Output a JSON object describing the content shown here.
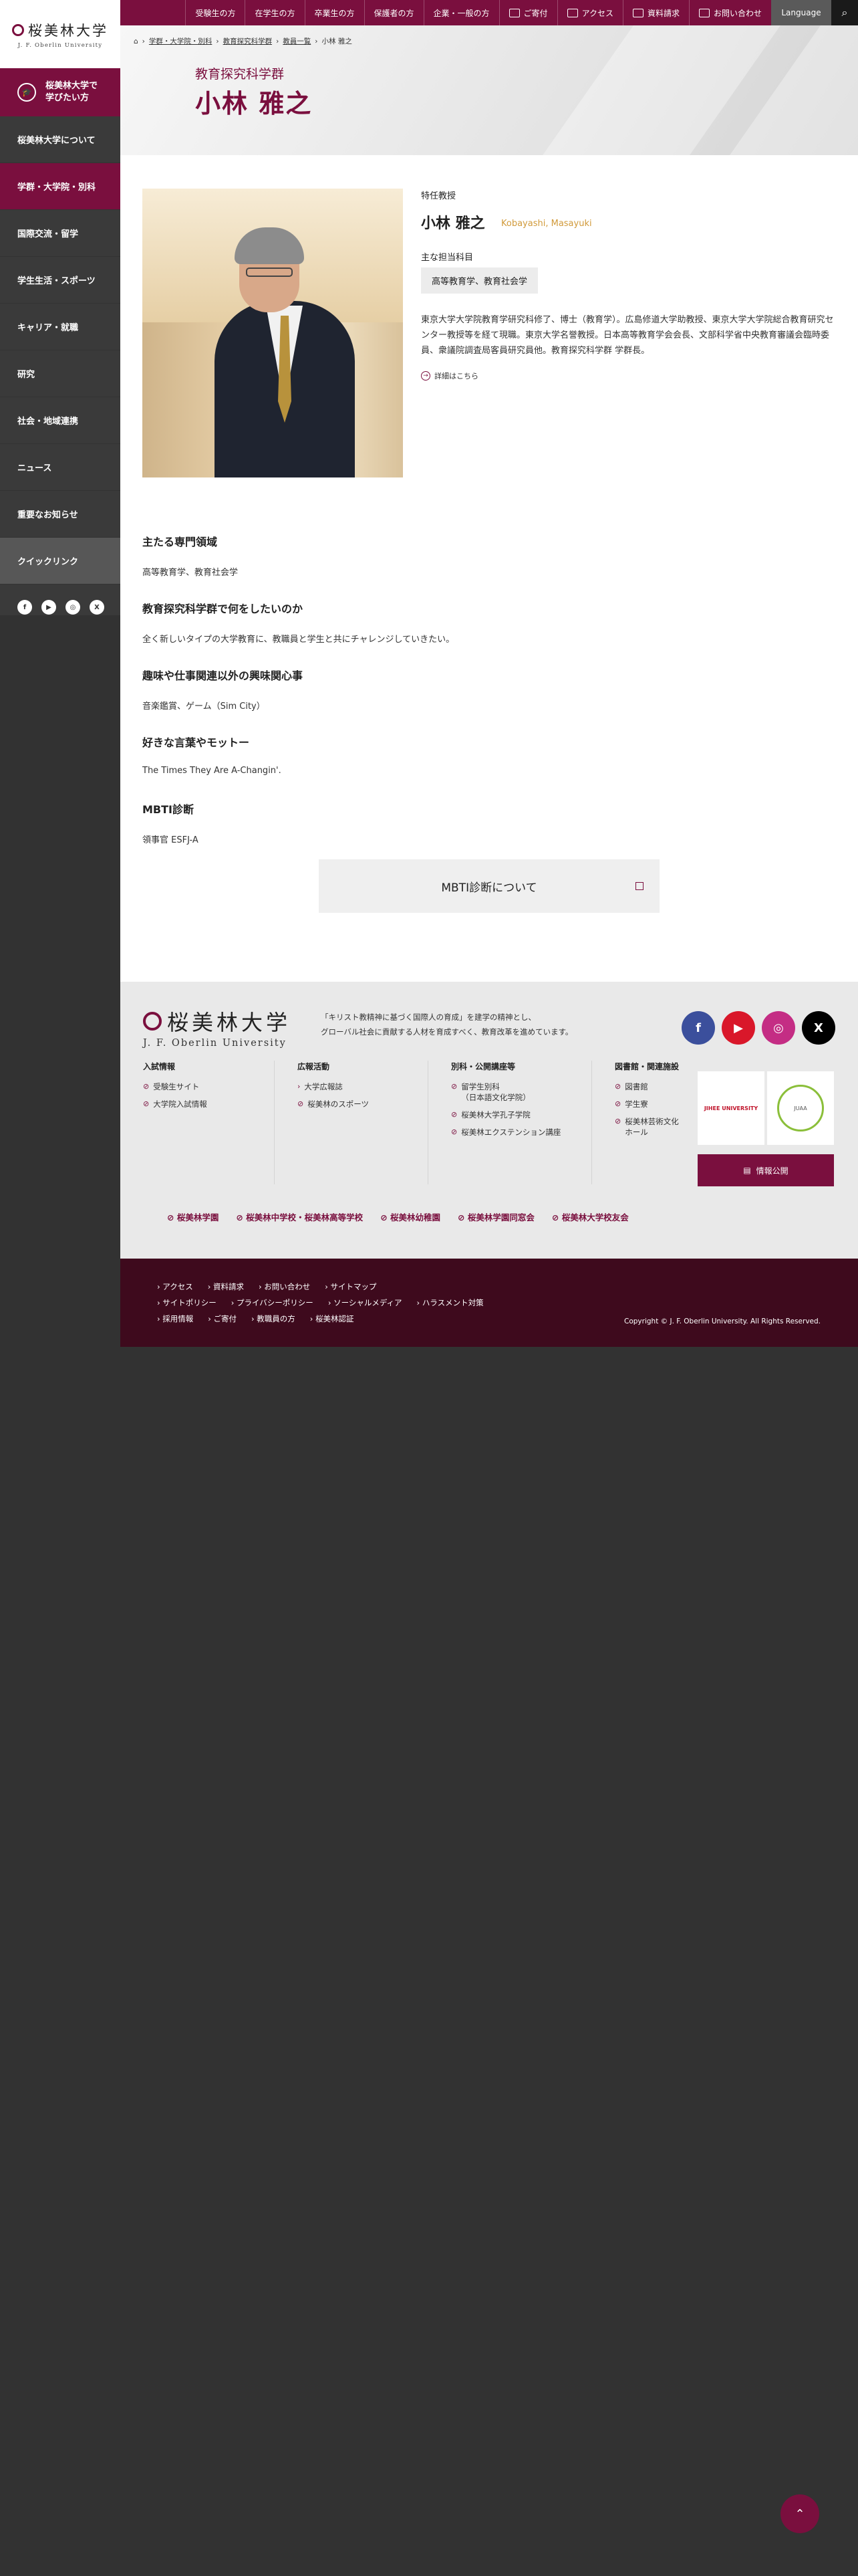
{
  "sidebar": {
    "logo_jp": "桜美林大学",
    "logo_en": "J. F. Oberlin University",
    "learn_label": "桜美林大学で\n学びたい方",
    "items": [
      {
        "label": "桜美林大学について"
      },
      {
        "label": "学群・大学院・別科"
      },
      {
        "label": "国際交流・留学"
      },
      {
        "label": "学生生活・スポーツ"
      },
      {
        "label": "キャリア・就職"
      },
      {
        "label": "研究"
      },
      {
        "label": "社会・地域連携"
      },
      {
        "label": "ニュース"
      },
      {
        "label": "重要なお知らせ"
      }
    ],
    "quick_link": "クイックリンク"
  },
  "topbar": {
    "links": [
      "受験生の方",
      "在学生の方",
      "卒業生の方",
      "保護者の方",
      "企業・一般の方"
    ],
    "icon_links": [
      "ご寄付",
      "アクセス",
      "資料請求",
      "お問い合わせ"
    ],
    "language": "Language"
  },
  "breadcrumb": [
    "学群・大学院・別科",
    "教育探究科学群",
    "教員一覧",
    "小林 雅之"
  ],
  "hero": {
    "department": "教育探究科学群",
    "name": "小林 雅之"
  },
  "profile": {
    "rank": "特任教授",
    "name": "小林 雅之",
    "romaji": "Kobayashi, Masayuki",
    "subjects_label": "主な担当科目",
    "subjects": "高等教育学、教育社会学",
    "bio": "東京大学大学院教育学研究科修了、博士（教育学）。広島修道大学助教授、東京大学大学院総合教育研究センター教授等を経て現職。東京大学名誉教授。日本高等教育学会会長、文部科学省中央教育審議会臨時委員、衆議院調査局客員研究員他。教育探究科学群 学群長。",
    "more_label": "詳細はこちら"
  },
  "sections": [
    {
      "heading": "主たる専門領域",
      "text": "高等教育学、教育社会学"
    },
    {
      "heading": "教育探究科学群で何をしたいのか",
      "text": "全く新しいタイプの大学教育に、教職員と学生と共にチャレンジしていきたい。"
    },
    {
      "heading": "趣味や仕事関連以外の興味関心事",
      "text": "音楽鑑賞、ゲーム（Sim City）"
    },
    {
      "heading": "好きな言葉やモットー",
      "text": "The Times They Are A-Changin'."
    },
    {
      "heading": "MBTI診断",
      "text": "領事官 ESFJ-A"
    }
  ],
  "mbti_button": "MBTI診断について",
  "footer": {
    "logo_jp": "桜美林大学",
    "logo_en": "J. F. Oberlin University",
    "tagline": "「キリスト教精神に基づく国際人の育成」を建学の精神とし、\nグローバル社会に貢献する人材を育成すべく、教育改革を進めています。",
    "columns": [
      {
        "title": "入試情報",
        "links": [
          "受験生サイト",
          "大学院入試情報"
        ]
      },
      {
        "title": "広報活動",
        "links": [
          "大学広報誌",
          "桜美林のスポーツ"
        ]
      },
      {
        "title": "別科・公開講座等",
        "links": [
          "留学生別科\n（日本語文化学院）",
          "桜美林大学孔子学院",
          "桜美林エクステンション講座"
        ]
      },
      {
        "title": "図書館・関連施設",
        "links": [
          "図書館",
          "学生寮",
          "桜美林芸術文化\nホール"
        ]
      }
    ],
    "cert1": "JIHEE UNIVERSITY",
    "cert2": "JUAA",
    "disclosure": "情報公開",
    "affiliates": [
      "桜美林学園",
      "桜美林中学校・桜美林高等学校",
      "桜美林幼稚園",
      "桜美林学園同窓会",
      "桜美林大学校友会"
    ],
    "bottom_links": [
      [
        "アクセス",
        "資料請求",
        "お問い合わせ",
        "サイトマップ"
      ],
      [
        "サイトポリシー",
        "プライバシーポリシー",
        "ソーシャルメディア",
        "ハラスメント対策"
      ],
      [
        "採用情報",
        "ご寄付",
        "教職員の方",
        "桜美林認証"
      ]
    ],
    "copyright": "Copyright © J. F. Oberlin University. All Rights Reserved."
  },
  "colors": {
    "brand": "#7a0f3e",
    "accent": "#d19a3a",
    "dark": "#3a3a3a"
  }
}
